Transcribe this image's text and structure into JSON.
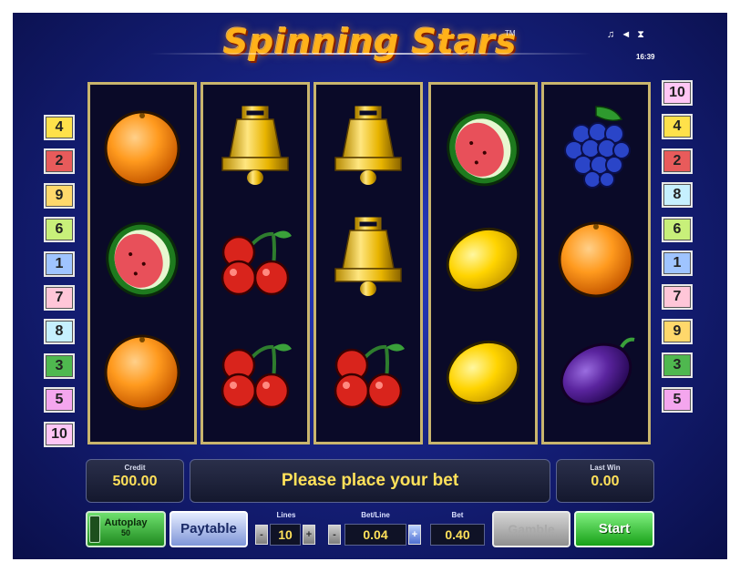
{
  "game": {
    "title": "Spinning Stars",
    "trademark": "TM",
    "clock": "16:39"
  },
  "status_icons": [
    "music-note-icon",
    "speaker-icon",
    "hourglass-icon"
  ],
  "paylines": {
    "left": [
      "4",
      "2",
      "9",
      "6",
      "1",
      "7",
      "8",
      "3",
      "5",
      "10"
    ],
    "right": [
      "10",
      "4",
      "2",
      "8",
      "6",
      "1",
      "7",
      "9",
      "3",
      "5"
    ]
  },
  "reels": [
    [
      "orange",
      "watermelon",
      "orange"
    ],
    [
      "bell",
      "cherries",
      "cherries"
    ],
    [
      "bell",
      "bell",
      "cherries"
    ],
    [
      "watermelon",
      "lemon",
      "lemon"
    ],
    [
      "grapes",
      "orange",
      "plum"
    ]
  ],
  "info": {
    "credit_label": "Credit",
    "credit_value": "500.00",
    "message": "Please place your bet",
    "last_win_label": "Last Win",
    "last_win_value": "0.00"
  },
  "controls": {
    "autoplay_label": "Autoplay",
    "autoplay_value": "50",
    "paytable_label": "Paytable",
    "lines_label": "Lines",
    "lines_value": "10",
    "bet_line_label": "Bet/Line",
    "bet_line_value": "0.04",
    "bet_label": "Bet",
    "bet_value": "0.40",
    "gamble_label": "Gamble",
    "start_label": "Start",
    "minus_symbol": "-",
    "plus_symbol": "+"
  },
  "colors": {
    "title": "#ffb11a",
    "value_text": "#ffe15a",
    "badges": {
      "1": "#9fc4ff",
      "2": "#e85b5b",
      "3": "#4fb84f",
      "4": "#ffe14a",
      "5": "#f4a6ee",
      "6": "#c8f07a",
      "7": "#ffc6d8",
      "8": "#c6f0ff",
      "9": "#ffd86b",
      "10": "#ffc6f5"
    }
  }
}
